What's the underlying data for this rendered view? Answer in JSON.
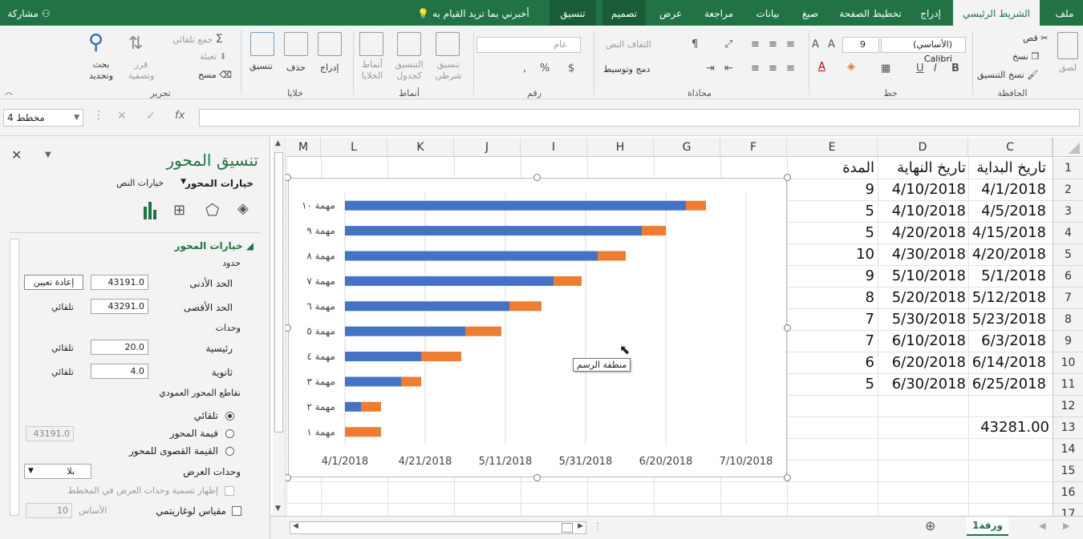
{
  "tabs": {
    "file": "ملف",
    "home": "الشريط الرئيسي",
    "insert": "إدراج",
    "page_layout": "تخطيط الصفحة",
    "formulas": "صيغ",
    "data": "بيانات",
    "review": "مراجعة",
    "view": "عرض",
    "design": "تصميم",
    "format": "تنسيق",
    "tell_me": "أخبرني بما تريد القيام به",
    "share": "مشاركة"
  },
  "ribbon": {
    "clipboard": {
      "label": "الحافظة",
      "paste": "لصق",
      "cut": "قص",
      "copy": "نسخ",
      "format_painter": "نسخ التنسيق"
    },
    "font": {
      "label": "خط",
      "name": "(الأساسي) Calibri",
      "size": "9",
      "bold": "B",
      "italic": "I",
      "underline": "U"
    },
    "alignment": {
      "label": "محاذاة",
      "wrap": "التفاف النص",
      "merge": "دمج وتوسيط"
    },
    "number": {
      "label": "رقم",
      "format": "عام"
    },
    "styles": {
      "label": "أنماط",
      "conditional": "تنسيق شرطي",
      "as_table": "التنسيق كجدول",
      "cell_styles": "أنماط الخلايا"
    },
    "cells": {
      "label": "خلايا",
      "insert": "إدراج",
      "delete": "حذف",
      "format": "تنسيق"
    },
    "editing": {
      "label": "تحرير",
      "autosum": "جمع تلقائي",
      "fill": "تعبئة",
      "clear": "مسح",
      "sort": "فرز وتصفية",
      "find": "بحث وتحديد"
    }
  },
  "formula_bar": {
    "name_box": "مخطط 4",
    "fx": "fx"
  },
  "pane": {
    "title": "تنسيق المحور",
    "tab_axis": "خيارات المحور",
    "tab_text": "خيارات النص",
    "section": "خيارات المحور",
    "bounds": "حدود",
    "min_label": "الحد الأدنى",
    "min_value": "43191.0",
    "min_btn": "إعادة تعيين",
    "max_label": "الحد الأقصى",
    "max_value": "43291.0",
    "max_auto": "تلقائي",
    "units": "وحدات",
    "major_label": "رئيسية",
    "major_value": "20.0",
    "major_auto": "تلقائي",
    "minor_label": "ثانوية",
    "minor_value": "4.0",
    "minor_auto": "تلقائي",
    "crosses": "تقاطع المحور العمودي",
    "auto_radio": "تلقائي",
    "axis_value_radio": "قيمة المحور",
    "axis_value": "43191.0",
    "max_radio": "القيمة القصوى للمحور",
    "display_units": "وحدات العرض",
    "display_units_value": "بلا",
    "show_units_label": "إظهار تسمية وحدات العرض في المخطط",
    "log_scale": "مقياس لوغاريتمي",
    "base_label": "الأساس",
    "base_value": "10"
  },
  "columns": [
    "C",
    "D",
    "E",
    "F",
    "G",
    "H",
    "I",
    "J",
    "K",
    "L",
    "M"
  ],
  "rows": [
    "1",
    "2",
    "3",
    "4",
    "5",
    "6",
    "7",
    "8",
    "9",
    "10",
    "11",
    "12",
    "13",
    "14",
    "15",
    "16",
    "17"
  ],
  "sheet": {
    "headers": {
      "c": "تاريخ البداية",
      "d": "تاريخ النهاية",
      "e": "المدة"
    },
    "rows": [
      {
        "c": "4/1/2018",
        "d": "4/10/2018",
        "e": "9"
      },
      {
        "c": "4/5/2018",
        "d": "4/10/2018",
        "e": "5"
      },
      {
        "c": "4/15/2018",
        "d": "4/20/2018",
        "e": "5"
      },
      {
        "c": "4/20/2018",
        "d": "4/30/2018",
        "e": "10"
      },
      {
        "c": "5/1/2018",
        "d": "5/10/2018",
        "e": "9"
      },
      {
        "c": "5/12/2018",
        "d": "5/20/2018",
        "e": "8"
      },
      {
        "c": "5/23/2018",
        "d": "5/30/2018",
        "e": "7"
      },
      {
        "c": "6/3/2018",
        "d": "6/10/2018",
        "e": "7"
      },
      {
        "c": "6/14/2018",
        "d": "6/20/2018",
        "e": "6"
      },
      {
        "c": "6/25/2018",
        "d": "6/30/2018",
        "e": "5"
      }
    ],
    "c13": "43281.00",
    "tab_name": "ورقة1"
  },
  "tooltip": "منطقة الرسم",
  "colors": {
    "accent": "#217346",
    "series_start": "#4472c4",
    "series_duration": "#ed7d31"
  },
  "chart_data": {
    "type": "bar",
    "orientation": "horizontal",
    "stacked": true,
    "categories": [
      "مهمة ١",
      "مهمة ٢",
      "مهمة ٣",
      "مهمة ٤",
      "مهمة ٥",
      "مهمة ٦",
      "مهمة ٧",
      "مهمة ٨",
      "مهمة ٩",
      "مهمة ١٠"
    ],
    "series": [
      {
        "values": [
          43191,
          43195,
          43205,
          43210,
          43221,
          43232,
          43243,
          43254,
          43265,
          43276
        ]
      },
      {
        "values": [
          9,
          5,
          5,
          10,
          9,
          8,
          7,
          7,
          6,
          5
        ]
      }
    ],
    "xlim": [
      43191,
      43291
    ],
    "x_major_unit": 20,
    "x_tick_labels": [
      "4/1/2018",
      "4/21/2018",
      "5/11/2018",
      "5/31/2018",
      "6/20/2018",
      "7/10/2018"
    ],
    "grid": true,
    "legend": "none"
  }
}
